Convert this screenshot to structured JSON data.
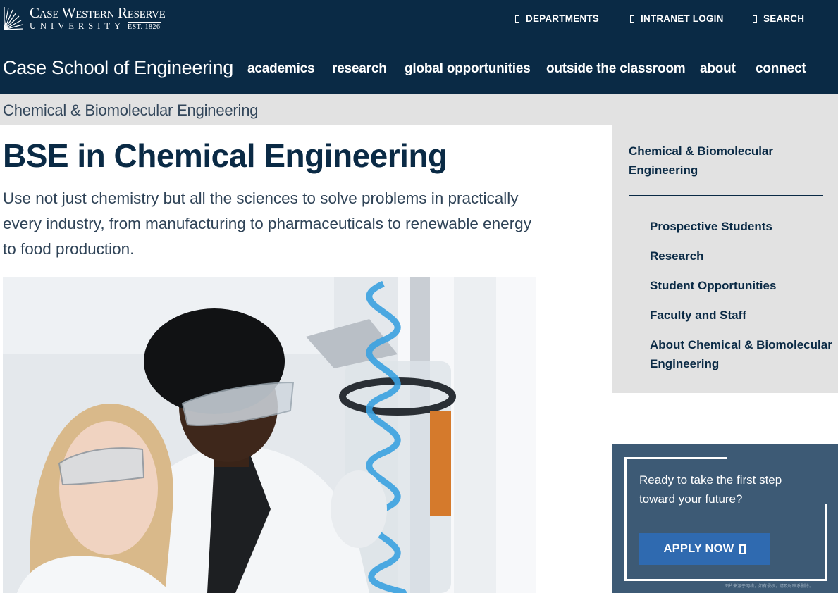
{
  "brand": {
    "logo_line1": "Case Western Reserve",
    "logo_line2": "UNIVERSITY",
    "logo_est": "EST. 1826"
  },
  "utility_nav": [
    {
      "label": "DEPARTMENTS"
    },
    {
      "label": "INTRANET LOGIN"
    },
    {
      "label": "SEARCH"
    }
  ],
  "main_nav": {
    "school_name": "Case School of Engineering",
    "items": [
      {
        "label": "academics"
      },
      {
        "label": "research"
      },
      {
        "label": "global opportunities"
      },
      {
        "label": "outside the classroom"
      },
      {
        "label": "about"
      },
      {
        "label": "connect"
      }
    ]
  },
  "breadcrumb": "Chemical & Biomolecular Engineering",
  "page": {
    "title": "BSE in Chemical Engineering",
    "lede": "Use not just chemistry but all the sciences to solve problems in practically every industry, from manufacturing to pharmaceuticals to renewable energy to food production."
  },
  "sidebar": {
    "heading": "Chemical & Biomolecular Engineering",
    "items": [
      {
        "label": "Prospective Students"
      },
      {
        "label": "Research"
      },
      {
        "label": "Student Opportunities"
      },
      {
        "label": "Faculty and Staff"
      },
      {
        "label": "About Chemical & Biomolecular Engineering"
      }
    ]
  },
  "cta": {
    "text": "Ready to take the first step toward your future?",
    "button_label": "APPLY NOW",
    "note": "图片来源于网络，如有侵权，请及时联系删除。"
  },
  "colors": {
    "navy": "#0a2a45",
    "breadcrumb_bg": "#e2e2e2",
    "cta_bg": "#3d5a75",
    "button_bg": "#2f6ab0"
  }
}
